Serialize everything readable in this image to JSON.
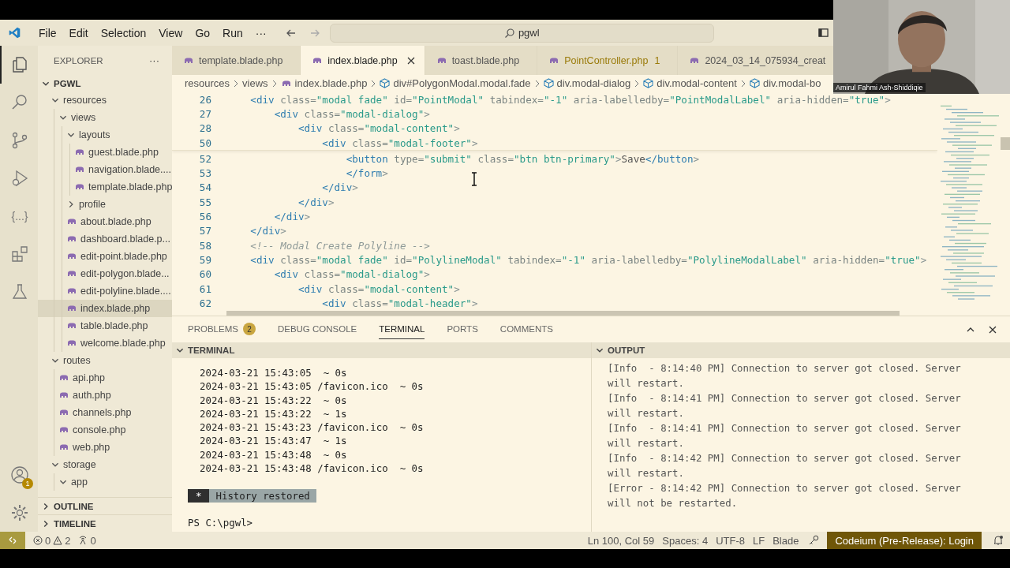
{
  "menu": [
    "File",
    "Edit",
    "Selection",
    "View",
    "Go",
    "Run",
    "···"
  ],
  "search": {
    "value": "pgwl"
  },
  "activity_bar": [
    {
      "kind": "explorer",
      "selected": true
    },
    {
      "kind": "search",
      "selected": false
    },
    {
      "kind": "source-control",
      "selected": false
    },
    {
      "kind": "run-debug",
      "selected": false
    },
    {
      "kind": "glyph",
      "glyph": "{...}",
      "selected": false
    },
    {
      "kind": "extensions",
      "selected": false
    },
    {
      "kind": "testing",
      "selected": false
    }
  ],
  "account": {
    "badge": "1"
  },
  "sidebar": {
    "title": "EXPLORER",
    "more": "···",
    "root": {
      "label": "PGWL",
      "expanded": true
    },
    "tree": [
      {
        "label": "resources",
        "kind": "folder",
        "expanded": true,
        "selected": false,
        "children": [
          {
            "label": "views",
            "kind": "folder",
            "expanded": true,
            "selected": false,
            "children": [
              {
                "label": "layouts",
                "kind": "folder",
                "expanded": true,
                "selected": false,
                "children": [
                  {
                    "label": "guest.blade.php",
                    "kind": "file",
                    "selected": false
                  },
                  {
                    "label": "navigation.blade....",
                    "kind": "file",
                    "selected": false
                  },
                  {
                    "label": "template.blade.php",
                    "kind": "file",
                    "selected": false
                  }
                ]
              },
              {
                "label": "profile",
                "kind": "folder",
                "expanded": false,
                "selected": false
              },
              {
                "label": "about.blade.php",
                "kind": "file",
                "selected": false
              },
              {
                "label": "dashboard.blade.p...",
                "kind": "file",
                "selected": false
              },
              {
                "label": "edit-point.blade.php",
                "kind": "file",
                "selected": false
              },
              {
                "label": "edit-polygon.blade...",
                "kind": "file",
                "selected": false
              },
              {
                "label": "edit-polyline.blade....",
                "kind": "file",
                "selected": false
              },
              {
                "label": "index.blade.php",
                "kind": "file",
                "selected": true
              },
              {
                "label": "table.blade.php",
                "kind": "file",
                "selected": false
              },
              {
                "label": "welcome.blade.php",
                "kind": "file",
                "selected": false
              }
            ]
          }
        ]
      },
      {
        "label": "routes",
        "kind": "folder",
        "expanded": true,
        "selected": false,
        "children": [
          {
            "label": "api.php",
            "kind": "file",
            "selected": false
          },
          {
            "label": "auth.php",
            "kind": "file",
            "selected": false
          },
          {
            "label": "channels.php",
            "kind": "file",
            "selected": false
          },
          {
            "label": "console.php",
            "kind": "file",
            "selected": false
          },
          {
            "label": "web.php",
            "kind": "file",
            "selected": false
          }
        ]
      },
      {
        "label": "storage",
        "kind": "folder",
        "expanded": true,
        "selected": false,
        "children": [
          {
            "label": "app",
            "kind": "folder",
            "expanded": true,
            "selected": false
          }
        ]
      }
    ],
    "sections": [
      {
        "label": "OUTLINE",
        "expanded": false
      },
      {
        "label": "TIMELINE",
        "expanded": false
      }
    ]
  },
  "tabs": [
    {
      "label": "template.blade.php",
      "selected": false
    },
    {
      "label": "index.blade.php",
      "selected": true
    },
    {
      "label": "toast.blade.php",
      "selected": false
    },
    {
      "label": "PointController.php",
      "problems": "1",
      "selected": false
    },
    {
      "label": "2024_03_14_075934_creat",
      "selected": false
    }
  ],
  "breadcrumbs": [
    {
      "label": "resources",
      "kind": "folder"
    },
    {
      "label": "views",
      "kind": "folder"
    },
    {
      "label": "index.blade.php",
      "kind": "file"
    },
    {
      "label": "div#PolygonModal.modal.fade",
      "kind": "element"
    },
    {
      "label": "div.modal-dialog",
      "kind": "element"
    },
    {
      "label": "div.modal-content",
      "kind": "element"
    },
    {
      "label": "div.modal-bo",
      "kind": "element"
    }
  ],
  "code": {
    "sticky_lines": [
      {
        "number": "26",
        "parts": [
          {
            "kind": "tag",
            "text": "    <div"
          },
          {
            "kind": "attr",
            "text": " class="
          },
          {
            "kind": "string",
            "text": "\"modal fade\""
          },
          {
            "kind": "attr",
            "text": " id="
          },
          {
            "kind": "string",
            "text": "\"PointModal\""
          },
          {
            "kind": "attr",
            "text": " tabindex="
          },
          {
            "kind": "string",
            "text": "\"-1\""
          },
          {
            "kind": "attr",
            "text": " aria-labelledby="
          },
          {
            "kind": "string",
            "text": "\"PointModalLabel\""
          },
          {
            "kind": "attr",
            "text": " aria-hidden="
          },
          {
            "kind": "string",
            "text": "\"true\""
          },
          {
            "kind": "punct",
            "text": ">"
          }
        ]
      },
      {
        "number": "27",
        "parts": [
          {
            "kind": "tag",
            "text": "        <div"
          },
          {
            "kind": "attr",
            "text": " class="
          },
          {
            "kind": "string",
            "text": "\"modal-dialog\""
          },
          {
            "kind": "punct",
            "text": ">"
          }
        ]
      },
      {
        "number": "28",
        "parts": [
          {
            "kind": "tag",
            "text": "            <div"
          },
          {
            "kind": "attr",
            "text": " class="
          },
          {
            "kind": "string",
            "text": "\"modal-content\""
          },
          {
            "kind": "punct",
            "text": ">"
          }
        ]
      },
      {
        "number": "50",
        "parts": [
          {
            "kind": "tag",
            "text": "                <div"
          },
          {
            "kind": "attr",
            "text": " class="
          },
          {
            "kind": "string",
            "text": "\"modal-footer\""
          },
          {
            "kind": "punct",
            "text": ">"
          }
        ]
      }
    ],
    "lines": [
      {
        "number": "52",
        "parts": [
          {
            "kind": "tag",
            "text": "                    <button"
          },
          {
            "kind": "attr",
            "text": " type="
          },
          {
            "kind": "string",
            "text": "\"submit\""
          },
          {
            "kind": "attr",
            "text": " class="
          },
          {
            "kind": "string",
            "text": "\"btn btn-primary\""
          },
          {
            "kind": "punct",
            "text": ">"
          },
          {
            "kind": "text",
            "text": "Save"
          },
          {
            "kind": "tag",
            "text": "</button"
          },
          {
            "kind": "punct",
            "text": ">"
          }
        ]
      },
      {
        "number": "53",
        "parts": [
          {
            "kind": "tag",
            "text": "                    </form"
          },
          {
            "kind": "punct",
            "text": ">"
          }
        ]
      },
      {
        "number": "54",
        "parts": [
          {
            "kind": "tag",
            "text": "                </div"
          },
          {
            "kind": "punct",
            "text": ">"
          }
        ]
      },
      {
        "number": "55",
        "parts": [
          {
            "kind": "tag",
            "text": "            </div"
          },
          {
            "kind": "punct",
            "text": ">"
          }
        ]
      },
      {
        "number": "56",
        "parts": [
          {
            "kind": "tag",
            "text": "        </div"
          },
          {
            "kind": "punct",
            "text": ">"
          }
        ]
      },
      {
        "number": "57",
        "parts": [
          {
            "kind": "tag",
            "text": "    </div"
          },
          {
            "kind": "punct",
            "text": ">"
          }
        ]
      },
      {
        "number": "58",
        "parts": [
          {
            "kind": "comment",
            "text": "    <!-- Modal Create Polyline -->"
          }
        ]
      },
      {
        "number": "59",
        "parts": [
          {
            "kind": "tag",
            "text": "    <div"
          },
          {
            "kind": "attr",
            "text": " class="
          },
          {
            "kind": "string",
            "text": "\"modal fade\""
          },
          {
            "kind": "attr",
            "text": " id="
          },
          {
            "kind": "string",
            "text": "\"PolylineModal\""
          },
          {
            "kind": "attr",
            "text": " tabindex="
          },
          {
            "kind": "string",
            "text": "\"-1\""
          },
          {
            "kind": "attr",
            "text": " aria-labelledby="
          },
          {
            "kind": "string",
            "text": "\"PolylineModalLabel\""
          },
          {
            "kind": "attr",
            "text": " aria-hidden="
          },
          {
            "kind": "string",
            "text": "\"true\""
          },
          {
            "kind": "punct",
            "text": ">"
          }
        ]
      },
      {
        "number": "60",
        "parts": [
          {
            "kind": "tag",
            "text": "        <div"
          },
          {
            "kind": "attr",
            "text": " class="
          },
          {
            "kind": "string",
            "text": "\"modal-dialog\""
          },
          {
            "kind": "punct",
            "text": ">"
          }
        ]
      },
      {
        "number": "61",
        "parts": [
          {
            "kind": "tag",
            "text": "            <div"
          },
          {
            "kind": "attr",
            "text": " class="
          },
          {
            "kind": "string",
            "text": "\"modal-content\""
          },
          {
            "kind": "punct",
            "text": ">"
          }
        ]
      },
      {
        "number": "62",
        "parts": [
          {
            "kind": "tag",
            "text": "                <div"
          },
          {
            "kind": "attr",
            "text": " class="
          },
          {
            "kind": "string",
            "text": "\"modal-header\""
          },
          {
            "kind": "punct",
            "text": ">"
          }
        ]
      }
    ]
  },
  "panel_tabs": [
    {
      "label": "PROBLEMS",
      "badge": "2",
      "selected": false
    },
    {
      "label": "DEBUG CONSOLE",
      "selected": false
    },
    {
      "label": "TERMINAL",
      "selected": true
    },
    {
      "label": "PORTS",
      "selected": false
    },
    {
      "label": "COMMENTS",
      "selected": false
    }
  ],
  "terminal": {
    "title": "TERMINAL",
    "expanded": true,
    "lines": [
      "2024-03-21 15:43:05  ~ 0s",
      "2024-03-21 15:43:05 /favicon.ico  ~ 0s",
      "2024-03-21 15:43:22  ~ 0s",
      "2024-03-21 15:43:22  ~ 1s",
      "2024-03-21 15:43:23 /favicon.ico  ~ 0s",
      "2024-03-21 15:43:47  ~ 1s",
      "2024-03-21 15:43:48  ~ 0s",
      "2024-03-21 15:43:48 /favicon.ico  ~ 0s"
    ],
    "notice": {
      "marker": "*",
      "text": "History restored"
    },
    "prompt": "PS C:\\pgwl>"
  },
  "output": {
    "title": "OUTPUT",
    "expanded": true,
    "lines": [
      "[Info  - 8:14:40 PM] Connection to server got closed. Server will restart.",
      "[Info  - 8:14:41 PM] Connection to server got closed. Server will restart.",
      "[Info  - 8:14:41 PM] Connection to server got closed. Server will restart.",
      "[Info  - 8:14:42 PM] Connection to server got closed. Server will restart.",
      "[Error - 8:14:42 PM] Connection to server got closed. Server will not be restarted."
    ]
  },
  "status_bar": {
    "errors": "0",
    "warnings": "2",
    "ports": "0",
    "items": [
      "Ln 100, Col 59",
      "Spaces: 4",
      "UTF-8",
      "LF",
      "Blade"
    ],
    "extension": "Codeium (Pre-Release): Login"
  },
  "webcam": {
    "kind": "picture",
    "name": "Amirul Fahmi Ash-Shiddiqie"
  }
}
